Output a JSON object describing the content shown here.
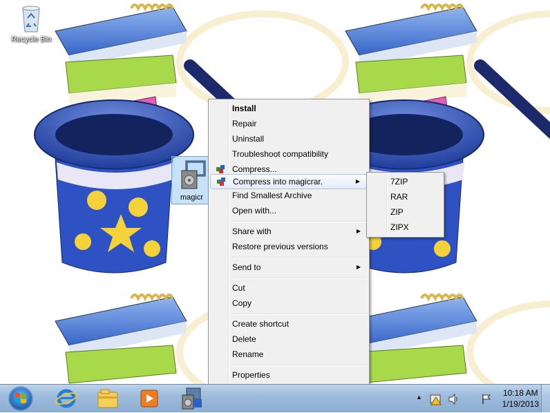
{
  "desktop": {
    "recycle_bin_label": "Recycle Bin",
    "selected_file_label": "magicr"
  },
  "context_menu": {
    "items": [
      {
        "label": "Install",
        "bold": true
      },
      {
        "label": "Repair"
      },
      {
        "label": "Uninstall"
      },
      {
        "label": "Troubleshoot compatibility"
      },
      {
        "label": "Compress...",
        "icon": "magicrar-icon"
      },
      {
        "label": "Compress into magicrar.",
        "icon": "magicrar-icon",
        "submenu": true,
        "highlighted": true
      },
      {
        "label": "Find Smallest Archive"
      },
      {
        "label": "Open with..."
      },
      {
        "label": "Share with",
        "submenu": true
      },
      {
        "label": "Restore previous versions"
      },
      {
        "label": "Send to",
        "submenu": true
      },
      {
        "label": "Cut"
      },
      {
        "label": "Copy"
      },
      {
        "label": "Create shortcut"
      },
      {
        "label": "Delete"
      },
      {
        "label": "Rename"
      },
      {
        "label": "Properties"
      }
    ]
  },
  "submenu": {
    "items": [
      "7ZIP",
      "RAR",
      "ZIP",
      "ZIPX"
    ]
  },
  "taskbar": {
    "pinned": [
      "start-orb",
      "internet-explorer-icon",
      "file-explorer-icon",
      "media-player-icon",
      "installer-icon"
    ],
    "time": "10:18 AM",
    "date": "1/19/2013"
  },
  "colors": {
    "menu_bg": "#f0f0f0",
    "highlight": "#e3ecf9",
    "taskbar": "#9fbcdc"
  }
}
